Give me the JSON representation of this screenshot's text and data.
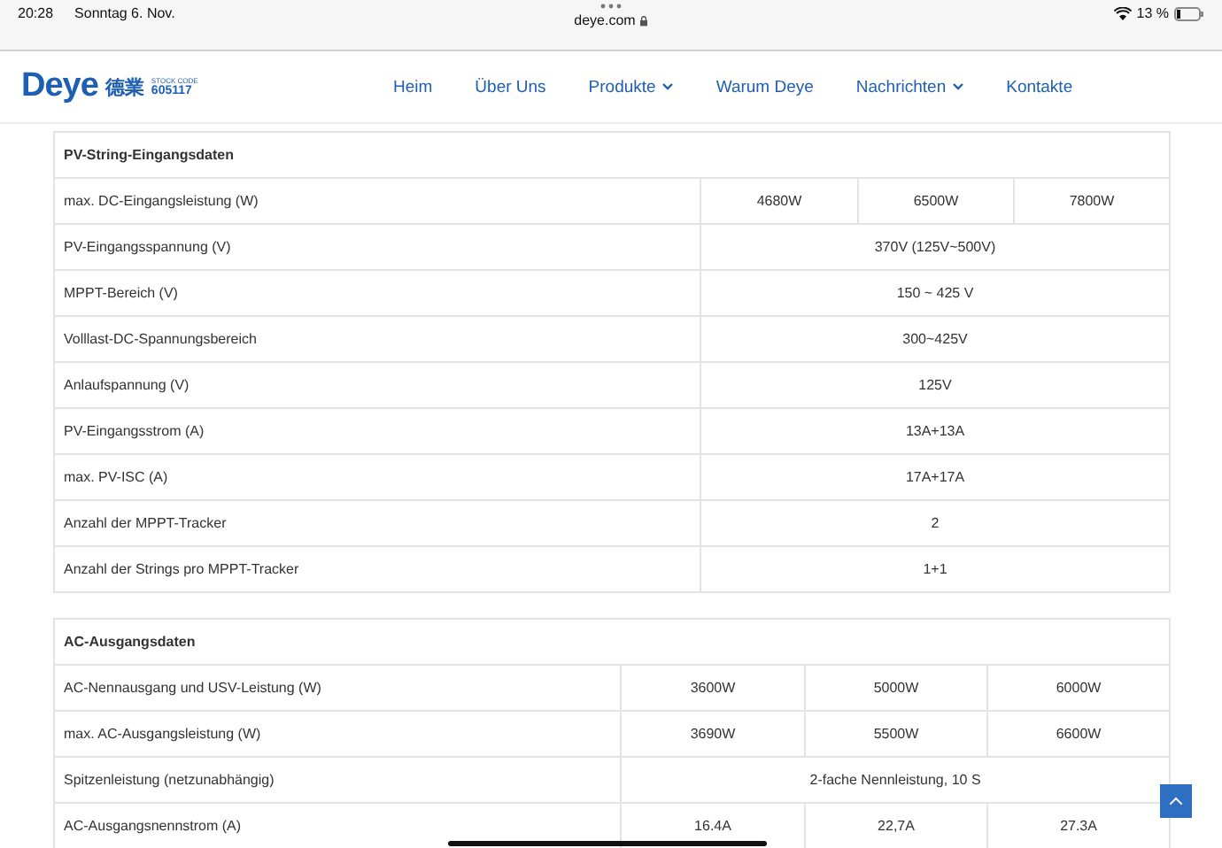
{
  "status_bar": {
    "time": "20:28",
    "date": "Sonntag 6. Nov.",
    "url": "deye.com",
    "battery_text": "13 %"
  },
  "logo": {
    "brand": "Deye",
    "chinese": "德業",
    "stock_label": "STOCK CODE",
    "stock_code": "605117"
  },
  "nav": [
    {
      "label": "Heim",
      "dropdown": false
    },
    {
      "label": "Über Uns",
      "dropdown": false
    },
    {
      "label": "Produkte",
      "dropdown": true
    },
    {
      "label": "Warum Deye",
      "dropdown": false
    },
    {
      "label": "Nachrichten",
      "dropdown": true
    },
    {
      "label": "Kontakte",
      "dropdown": false
    }
  ],
  "tables": [
    {
      "title": "PV-String-Eingangsdaten",
      "rows": [
        {
          "label": "max. DC-Eingangsleistung (W)",
          "values": [
            "4680W",
            "6500W",
            "7800W"
          ]
        },
        {
          "label": "PV-Eingangsspannung (V)",
          "values": [
            "370V (125V~500V)"
          ]
        },
        {
          "label": "MPPT-Bereich (V)",
          "values": [
            "150 ~ 425 V"
          ]
        },
        {
          "label": "Volllast-DC-Spannungsbereich",
          "values": [
            "300~425V"
          ]
        },
        {
          "label": "Anlaufspannung (V)",
          "values": [
            "125V"
          ]
        },
        {
          "label": "PV-Eingangsstrom (A)",
          "values": [
            "13A+13A"
          ]
        },
        {
          "label": "max. PV-ISC (A)",
          "values": [
            "17A+17A"
          ]
        },
        {
          "label": "Anzahl der MPPT-Tracker",
          "values": [
            "2"
          ]
        },
        {
          "label": "Anzahl der Strings pro MPPT-Tracker",
          "values": [
            "1+1"
          ]
        }
      ]
    },
    {
      "title": "AC-Ausgangsdaten",
      "rows": [
        {
          "label": "AC-Nennausgang und USV-Leistung (W)",
          "values": [
            "3600W",
            "5000W",
            "6000W"
          ]
        },
        {
          "label": "max. AC-Ausgangsleistung (W)",
          "values": [
            "3690W",
            "5500W",
            "6600W"
          ]
        },
        {
          "label": "Spitzenleistung (netzunabhängig)",
          "values": [
            "2-fache Nennleistung, 10 S"
          ]
        },
        {
          "label": "AC-Ausgangsnennstrom (A)",
          "values": [
            "16.4A",
            "22,7A",
            "27.3A"
          ]
        }
      ]
    }
  ]
}
